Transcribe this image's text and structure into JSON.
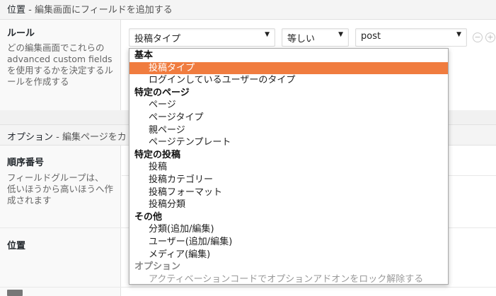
{
  "location_section": {
    "title": "位置",
    "subtitle": " - 編集画面にフィールドを追加する"
  },
  "rules": {
    "label": "ルール",
    "description": "どの編集画面でこれらの advanced custom fields を使用するかを決定するルールを作成する",
    "param_select": "投稿タイプ",
    "operator_select": "等しい",
    "value_select": "post",
    "remove_icon": "minus-circle-icon",
    "add_icon": "plus-circle-icon"
  },
  "options_section": {
    "title": "オプション",
    "subtitle": " - 編集ページをカ"
  },
  "order": {
    "label": "順序番号",
    "description": "フィールドグループは、\n低いほうから高いほうへ作成されます"
  },
  "position": {
    "label": "位置"
  },
  "dropdown": {
    "groups": [
      {
        "label": "基本",
        "items": [
          {
            "label": "投稿タイプ",
            "selected": true
          },
          {
            "label": "ログインしているユーザーのタイプ"
          }
        ]
      },
      {
        "label": "特定のページ",
        "items": [
          {
            "label": "ページ"
          },
          {
            "label": "ページタイプ"
          },
          {
            "label": "親ページ"
          },
          {
            "label": "ページテンプレート"
          }
        ]
      },
      {
        "label": "特定の投稿",
        "items": [
          {
            "label": "投稿"
          },
          {
            "label": "投稿カテゴリー"
          },
          {
            "label": "投稿フォーマット"
          },
          {
            "label": "投稿分類"
          }
        ]
      },
      {
        "label": "その他",
        "items": [
          {
            "label": "分類(追加/編集)"
          },
          {
            "label": "ユーザー(追加/編集)"
          },
          {
            "label": "メディア(編集)"
          }
        ]
      },
      {
        "label": "オプション",
        "disabled": true,
        "items": [
          {
            "label": "アクティベーションコードでオプションアドオンをロック解除する",
            "disabled": true
          }
        ]
      }
    ]
  },
  "colors": {
    "selected_bg": "#f07c3f"
  }
}
